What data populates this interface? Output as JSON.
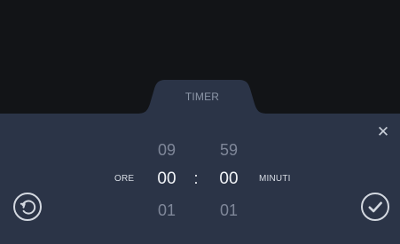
{
  "tab": {
    "label": "TIMER"
  },
  "timer": {
    "hours_label": "ORE",
    "minutes_label": "MINUTI",
    "colon": ":",
    "hours": {
      "previous": "09",
      "current": "00",
      "next": "01"
    },
    "minutes": {
      "previous": "59",
      "current": "00",
      "next": "01"
    }
  },
  "icons": {
    "close": "close-icon",
    "reset": "reset-icon",
    "confirm": "check-icon"
  },
  "colors": {
    "background": "#121417",
    "panel": "#2b3447",
    "tab": "#2b3447",
    "text_primary": "#f1f4f8",
    "text_dim": "#7f8799",
    "icon": "#d3d8e0"
  }
}
